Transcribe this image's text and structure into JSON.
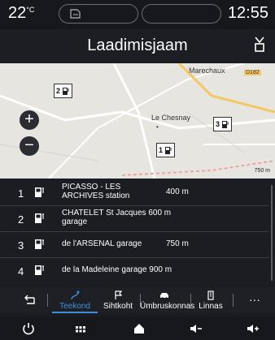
{
  "status": {
    "temperature": "22",
    "temp_unit": "°C",
    "clock": "12:55"
  },
  "header": {
    "title": "Laadimisjaam"
  },
  "map": {
    "zoom_in": "+",
    "zoom_out": "−",
    "labels": {
      "place": "Le Chesnay",
      "north": "Marechaux",
      "road": "D182",
      "scale": "750 m"
    },
    "markers": [
      {
        "num": "2"
      },
      {
        "num": "3"
      },
      {
        "num": "1"
      }
    ]
  },
  "stations": [
    {
      "index": "1",
      "name": "PICASSO - LES ARCHIVES station",
      "distance": "400 m"
    },
    {
      "index": "2",
      "name": "CHATELET St Jacques 600 m garage",
      "distance": ""
    },
    {
      "index": "3",
      "name": "de l'ARSENAL garage",
      "distance": "750 m"
    },
    {
      "index": "4",
      "name": "de la Madeleine garage 900 m",
      "distance": ""
    }
  ],
  "tabs": {
    "back_icon": "back-arrow-icon",
    "items": [
      {
        "label": "Teekond",
        "icon": "route-icon",
        "active": true
      },
      {
        "label": "Sihtkoht",
        "icon": "flag-icon",
        "active": false
      },
      {
        "label": "Ümbruskonnas",
        "icon": "car-icon",
        "active": false
      },
      {
        "label": "Linnas",
        "icon": "building-icon",
        "active": false
      }
    ],
    "more": "···"
  },
  "colors": {
    "accent": "#3e8edc",
    "background": "#1a1c21"
  }
}
